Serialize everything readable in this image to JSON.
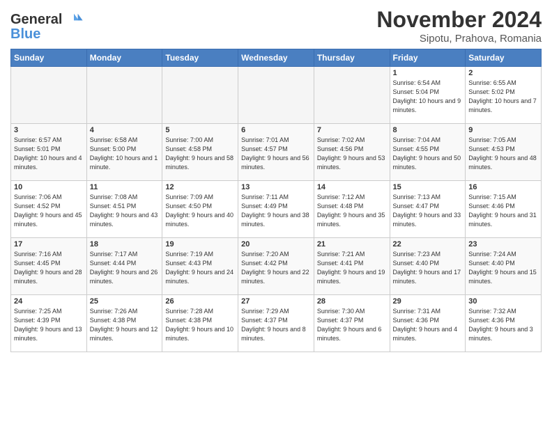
{
  "header": {
    "logo_line1": "General",
    "logo_line2": "Blue",
    "month": "November 2024",
    "location": "Sipotu, Prahova, Romania"
  },
  "weekdays": [
    "Sunday",
    "Monday",
    "Tuesday",
    "Wednesday",
    "Thursday",
    "Friday",
    "Saturday"
  ],
  "weeks": [
    [
      {
        "day": "",
        "info": ""
      },
      {
        "day": "",
        "info": ""
      },
      {
        "day": "",
        "info": ""
      },
      {
        "day": "",
        "info": ""
      },
      {
        "day": "",
        "info": ""
      },
      {
        "day": "1",
        "info": "Sunrise: 6:54 AM\nSunset: 5:04 PM\nDaylight: 10 hours and 9 minutes."
      },
      {
        "day": "2",
        "info": "Sunrise: 6:55 AM\nSunset: 5:02 PM\nDaylight: 10 hours and 7 minutes."
      }
    ],
    [
      {
        "day": "3",
        "info": "Sunrise: 6:57 AM\nSunset: 5:01 PM\nDaylight: 10 hours and 4 minutes."
      },
      {
        "day": "4",
        "info": "Sunrise: 6:58 AM\nSunset: 5:00 PM\nDaylight: 10 hours and 1 minute."
      },
      {
        "day": "5",
        "info": "Sunrise: 7:00 AM\nSunset: 4:58 PM\nDaylight: 9 hours and 58 minutes."
      },
      {
        "day": "6",
        "info": "Sunrise: 7:01 AM\nSunset: 4:57 PM\nDaylight: 9 hours and 56 minutes."
      },
      {
        "day": "7",
        "info": "Sunrise: 7:02 AM\nSunset: 4:56 PM\nDaylight: 9 hours and 53 minutes."
      },
      {
        "day": "8",
        "info": "Sunrise: 7:04 AM\nSunset: 4:55 PM\nDaylight: 9 hours and 50 minutes."
      },
      {
        "day": "9",
        "info": "Sunrise: 7:05 AM\nSunset: 4:53 PM\nDaylight: 9 hours and 48 minutes."
      }
    ],
    [
      {
        "day": "10",
        "info": "Sunrise: 7:06 AM\nSunset: 4:52 PM\nDaylight: 9 hours and 45 minutes."
      },
      {
        "day": "11",
        "info": "Sunrise: 7:08 AM\nSunset: 4:51 PM\nDaylight: 9 hours and 43 minutes."
      },
      {
        "day": "12",
        "info": "Sunrise: 7:09 AM\nSunset: 4:50 PM\nDaylight: 9 hours and 40 minutes."
      },
      {
        "day": "13",
        "info": "Sunrise: 7:11 AM\nSunset: 4:49 PM\nDaylight: 9 hours and 38 minutes."
      },
      {
        "day": "14",
        "info": "Sunrise: 7:12 AM\nSunset: 4:48 PM\nDaylight: 9 hours and 35 minutes."
      },
      {
        "day": "15",
        "info": "Sunrise: 7:13 AM\nSunset: 4:47 PM\nDaylight: 9 hours and 33 minutes."
      },
      {
        "day": "16",
        "info": "Sunrise: 7:15 AM\nSunset: 4:46 PM\nDaylight: 9 hours and 31 minutes."
      }
    ],
    [
      {
        "day": "17",
        "info": "Sunrise: 7:16 AM\nSunset: 4:45 PM\nDaylight: 9 hours and 28 minutes."
      },
      {
        "day": "18",
        "info": "Sunrise: 7:17 AM\nSunset: 4:44 PM\nDaylight: 9 hours and 26 minutes."
      },
      {
        "day": "19",
        "info": "Sunrise: 7:19 AM\nSunset: 4:43 PM\nDaylight: 9 hours and 24 minutes."
      },
      {
        "day": "20",
        "info": "Sunrise: 7:20 AM\nSunset: 4:42 PM\nDaylight: 9 hours and 22 minutes."
      },
      {
        "day": "21",
        "info": "Sunrise: 7:21 AM\nSunset: 4:41 PM\nDaylight: 9 hours and 19 minutes."
      },
      {
        "day": "22",
        "info": "Sunrise: 7:23 AM\nSunset: 4:40 PM\nDaylight: 9 hours and 17 minutes."
      },
      {
        "day": "23",
        "info": "Sunrise: 7:24 AM\nSunset: 4:40 PM\nDaylight: 9 hours and 15 minutes."
      }
    ],
    [
      {
        "day": "24",
        "info": "Sunrise: 7:25 AM\nSunset: 4:39 PM\nDaylight: 9 hours and 13 minutes."
      },
      {
        "day": "25",
        "info": "Sunrise: 7:26 AM\nSunset: 4:38 PM\nDaylight: 9 hours and 12 minutes."
      },
      {
        "day": "26",
        "info": "Sunrise: 7:28 AM\nSunset: 4:38 PM\nDaylight: 9 hours and 10 minutes."
      },
      {
        "day": "27",
        "info": "Sunrise: 7:29 AM\nSunset: 4:37 PM\nDaylight: 9 hours and 8 minutes."
      },
      {
        "day": "28",
        "info": "Sunrise: 7:30 AM\nSunset: 4:37 PM\nDaylight: 9 hours and 6 minutes."
      },
      {
        "day": "29",
        "info": "Sunrise: 7:31 AM\nSunset: 4:36 PM\nDaylight: 9 hours and 4 minutes."
      },
      {
        "day": "30",
        "info": "Sunrise: 7:32 AM\nSunset: 4:36 PM\nDaylight: 9 hours and 3 minutes."
      }
    ]
  ]
}
